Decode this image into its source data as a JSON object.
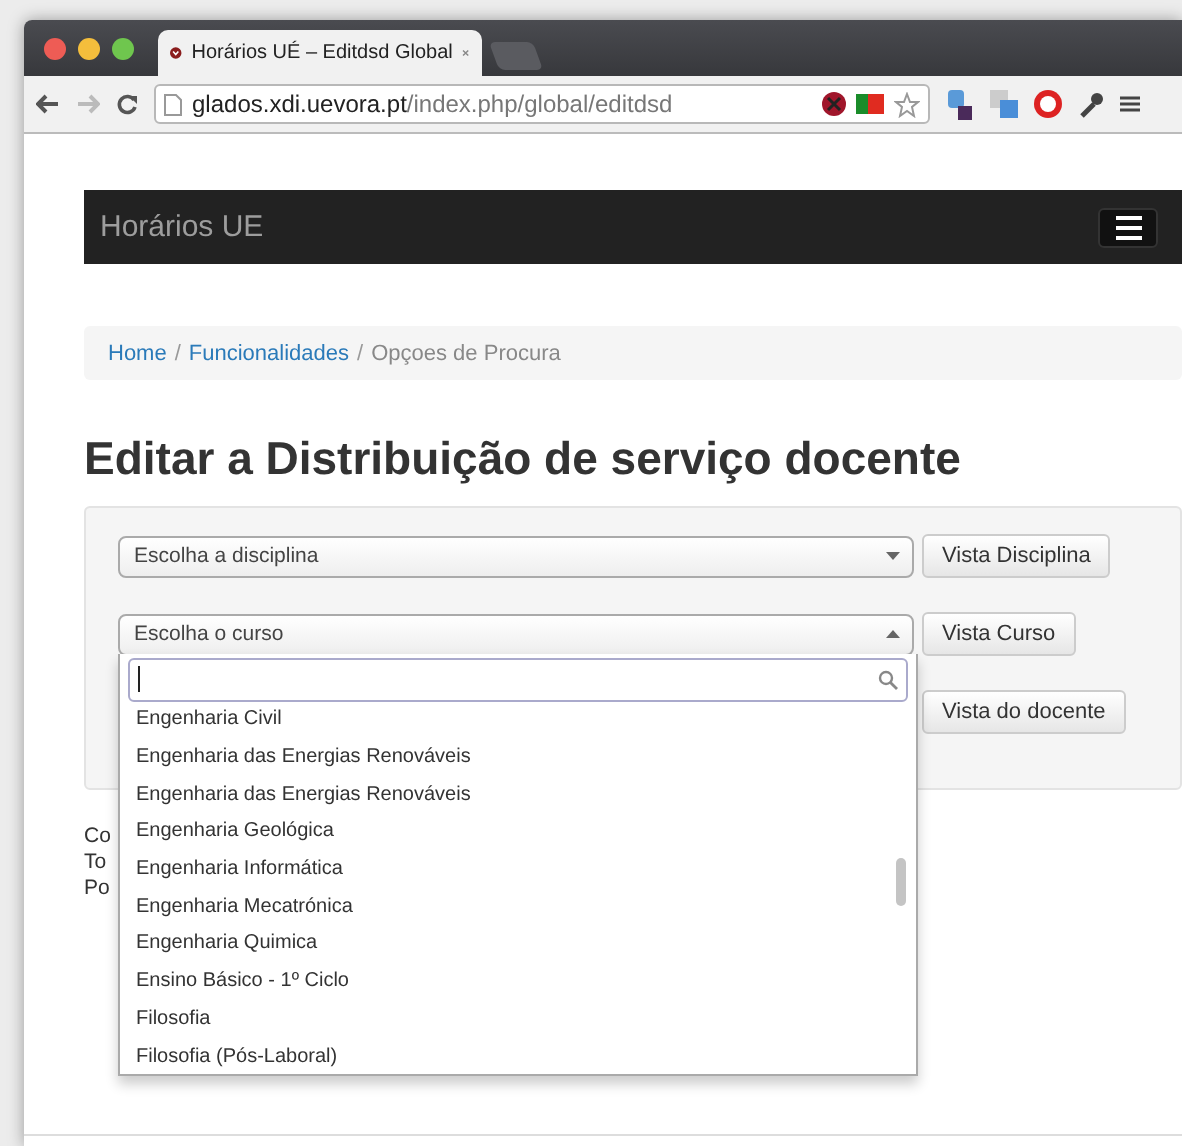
{
  "browser": {
    "tab_title": "Horários UÉ – Editdsd Global",
    "url_host": "glados.xdi.uevora.pt",
    "url_path": "/index.php/global/editdsd"
  },
  "navbar": {
    "brand": "Horários UE"
  },
  "breadcrumb": {
    "separator": "/",
    "items": [
      {
        "label": "Home",
        "active": false
      },
      {
        "label": "Funcionalidades",
        "active": false
      },
      {
        "label": "Opçoes de Procura",
        "active": true
      }
    ]
  },
  "heading": "Editar a Distribuição de serviço docente",
  "form": {
    "rows": [
      {
        "kind": "select",
        "placeholder": "Escolha a disciplina",
        "expanded": false,
        "button": "Vista Disciplina"
      },
      {
        "kind": "select",
        "placeholder": "Escolha o curso",
        "expanded": true,
        "button": "Vista Curso"
      },
      {
        "kind": "button_only",
        "button": "Vista do docente"
      }
    ]
  },
  "dropdown": {
    "options": [
      "Engenharia Civil",
      "Engenharia das Energias Renováveis",
      "Engenharia das Energias Renováveis",
      "Engenharia Geológica",
      "Engenharia Informática",
      "Engenharia Mecatrónica",
      "Engenharia Quimica",
      "Ensino Básico - 1º Ciclo",
      "Filosofia",
      "Filosofia (Pós-Laboral)"
    ]
  },
  "footer": [
    "Co",
    "To",
    "Po"
  ]
}
